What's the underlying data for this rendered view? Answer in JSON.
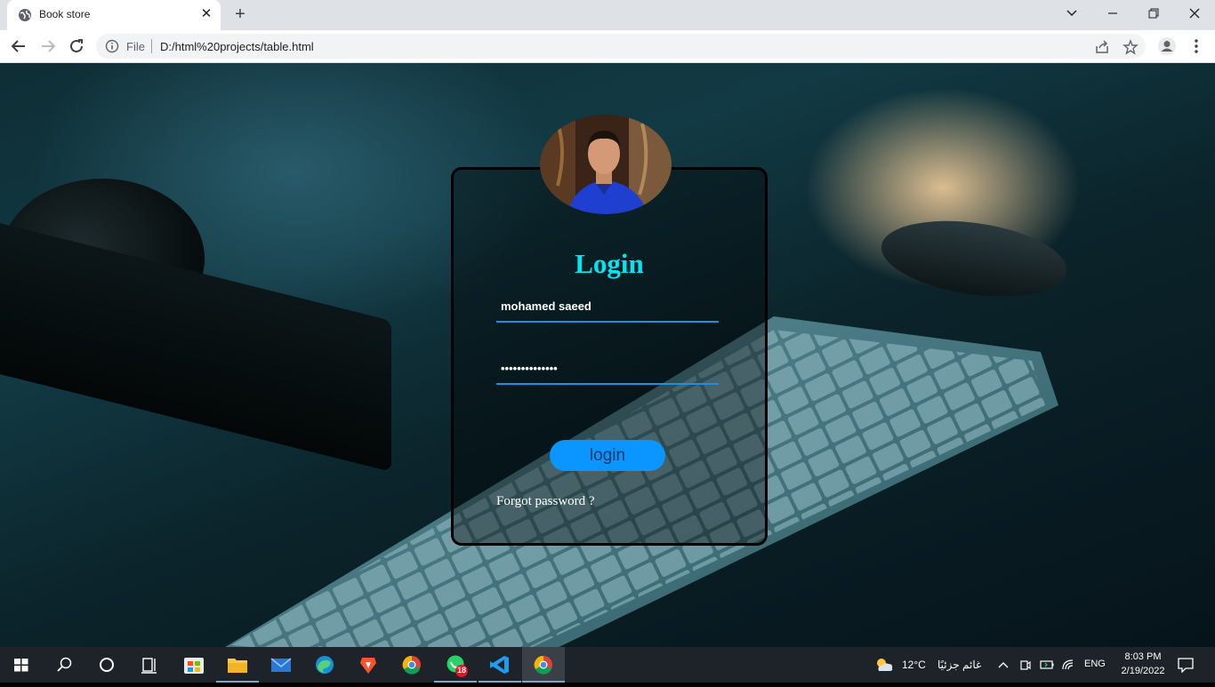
{
  "browser": {
    "tab_title": "Book store",
    "file_label": "File",
    "url": "D:/html%20projects/table.html"
  },
  "login": {
    "title": "Login",
    "username_value": "mohamed saeed",
    "password_value": "••••••••••••••",
    "button_label": "login",
    "forgot_label": "Forgot password ?",
    "accent_color": "#00e5f2",
    "button_color": "#0a95ff"
  },
  "taskbar": {
    "weather_temp": "12°C",
    "weather_text": "غائم جزئيًا",
    "language": "ENG",
    "time": "8:03 PM",
    "date": "2/19/2022",
    "whatsapp_badge": "18"
  }
}
